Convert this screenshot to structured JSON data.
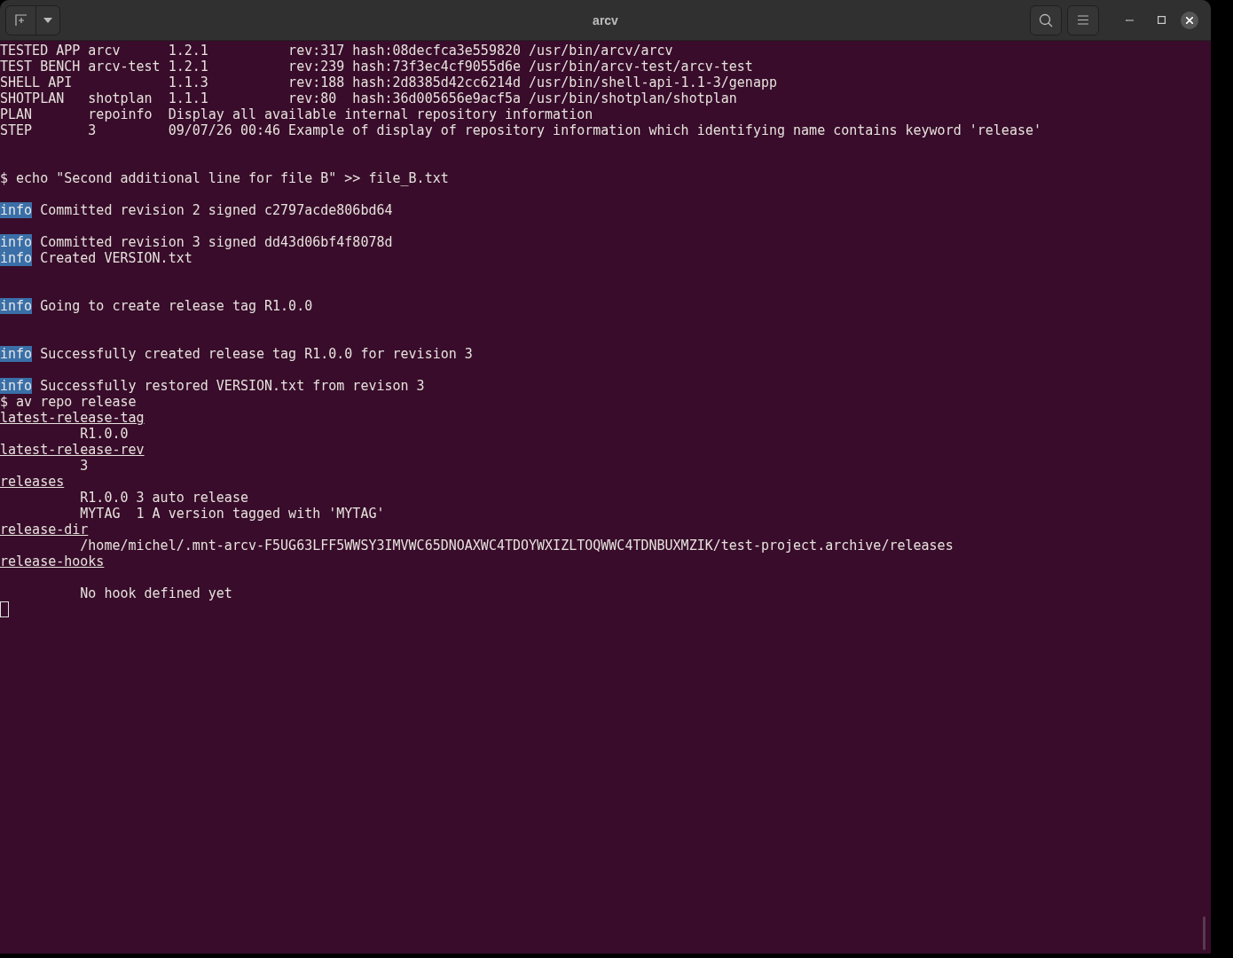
{
  "window": {
    "title": "arcv"
  },
  "lines": [
    {
      "kind": "text",
      "text": "TESTED APP arcv      1.2.1          rev:317 hash:08decfca3e559820 /usr/bin/arcv/arcv"
    },
    {
      "kind": "text",
      "text": "TEST BENCH arcv-test 1.2.1          rev:239 hash:73f3ec4cf9055d6e /usr/bin/arcv-test/arcv-test"
    },
    {
      "kind": "text",
      "text": "SHELL API            1.1.3          rev:188 hash:2d8385d42cc6214d /usr/bin/shell-api-1.1-3/genapp"
    },
    {
      "kind": "text",
      "text": "SHOTPLAN   shotplan  1.1.1          rev:80  hash:36d005656e9acf5a /usr/bin/shotplan/shotplan"
    },
    {
      "kind": "text",
      "text": "PLAN       repoinfo  Display all available internal repository information"
    },
    {
      "kind": "text",
      "text": "STEP       3         09/07/26 00:46 Example of display of repository information which identifying name contains keyword 'release'"
    },
    {
      "kind": "blank"
    },
    {
      "kind": "blank"
    },
    {
      "kind": "text",
      "text": "$ echo \"Second additional line for file B\" >> file_B.txt"
    },
    {
      "kind": "blank"
    },
    {
      "kind": "info",
      "tag": "info",
      "text": "Committed revision 2 signed c2797acde806bd64"
    },
    {
      "kind": "blank"
    },
    {
      "kind": "info",
      "tag": "info",
      "text": "Committed revision 3 signed dd43d06bf4f8078d"
    },
    {
      "kind": "info",
      "tag": "info",
      "text": "Created VERSION.txt"
    },
    {
      "kind": "blank"
    },
    {
      "kind": "blank"
    },
    {
      "kind": "info",
      "tag": "info",
      "text": "Going to create release tag R1.0.0"
    },
    {
      "kind": "blank"
    },
    {
      "kind": "blank"
    },
    {
      "kind": "info",
      "tag": "info",
      "text": "Successfully created release tag R1.0.0 for revision 3"
    },
    {
      "kind": "blank"
    },
    {
      "kind": "info",
      "tag": "info",
      "text": "Successfully restored VERSION.txt from revison 3"
    },
    {
      "kind": "text",
      "text": "$ av repo release"
    },
    {
      "kind": "heading",
      "text": "latest-release-tag"
    },
    {
      "kind": "text",
      "text": "          R1.0.0"
    },
    {
      "kind": "heading",
      "text": "latest-release-rev"
    },
    {
      "kind": "text",
      "text": "          3"
    },
    {
      "kind": "heading",
      "text": "releases"
    },
    {
      "kind": "text",
      "text": "          R1.0.0 3 auto release"
    },
    {
      "kind": "text",
      "text": "          MYTAG  1 A version tagged with 'MYTAG'"
    },
    {
      "kind": "heading",
      "text": "release-dir"
    },
    {
      "kind": "text",
      "text": "          /home/michel/.mnt-arcv-F5UG63LFF5WWSY3IMVWC65DNOAXWC4TDOYWXIZLTOQWWC4TDNBUXMZIK/test-project.archive/releases"
    },
    {
      "kind": "heading",
      "text": "release-hooks"
    },
    {
      "kind": "blank"
    },
    {
      "kind": "text",
      "text": "          No hook defined yet"
    },
    {
      "kind": "cursor"
    }
  ]
}
